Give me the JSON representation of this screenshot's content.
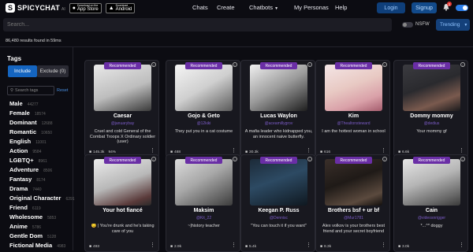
{
  "header": {
    "logo_text": "SPICYCHAT",
    "logo_version": "AI",
    "appstore_small": "Download on the",
    "appstore_big": "App Store",
    "android_small": "Download",
    "android_big": "Android",
    "nav": [
      "Chats",
      "Create",
      "Chatbots",
      "My Personas",
      "Help"
    ],
    "login_label": "Login",
    "signup_label": "Signup",
    "notification_count": "1"
  },
  "search": {
    "placeholder": "Search..."
  },
  "filters": {
    "nsfw_label": "NSFW",
    "sort_label": "Trending"
  },
  "results_text": "86,480 results found in 59ms",
  "sidebar": {
    "title": "Tags",
    "include_label": "Include",
    "exclude_label": "Exclude (0)",
    "search_placeholder": "Search tags",
    "reset_label": "Reset",
    "tags": [
      {
        "name": "Male",
        "count": "44277"
      },
      {
        "name": "Female",
        "count": "18574"
      },
      {
        "name": "Dominant",
        "count": "12688"
      },
      {
        "name": "Romantic",
        "count": "10650"
      },
      {
        "name": "English",
        "count": "11001"
      },
      {
        "name": "Action",
        "count": "9584"
      },
      {
        "name": "LGBTQ+",
        "count": "8961"
      },
      {
        "name": "Adventure",
        "count": "8506"
      },
      {
        "name": "Fantasy",
        "count": "8174"
      },
      {
        "name": "Drama",
        "count": "7440"
      },
      {
        "name": "Original Character",
        "count": "6291"
      },
      {
        "name": "Friend",
        "count": "6119"
      },
      {
        "name": "Wholesome",
        "count": "5853"
      },
      {
        "name": "Anime",
        "count": "5786"
      },
      {
        "name": "Gentle Dom",
        "count": "5128"
      },
      {
        "name": "Fictional Media",
        "count": "4983"
      }
    ]
  },
  "cards": [
    {
      "badge": "Recommended",
      "name": "Caesar",
      "handle": "@januarybay",
      "desc": "Cruel and cold General of the Combat Troops X Ordinary soldier (user)",
      "stat": "145.3k",
      "extra": "94%"
    },
    {
      "badge": "Recommended",
      "name": "Gojo & Geto",
      "handle": "@12kiki",
      "desc": "They put you in a cat costume",
      "stat": "488",
      "extra": ""
    },
    {
      "badge": "Recommended",
      "name": "Lucas Waylon",
      "handle": "@aceamillygrov",
      "desc": "A mafia leader who kidnapped you, an innocent naive butterfly.",
      "stat": "30.3k",
      "extra": ""
    },
    {
      "badge": "Recommended",
      "name": "Kim",
      "handle": "@Thealtonsteward",
      "desc": "I am the hottest woman in school",
      "stat": "616",
      "extra": ""
    },
    {
      "badge": "Recommended",
      "name": "Dommy mommy",
      "handle": "@dedius",
      "desc": "Your mommy gf",
      "stat": "6.6k",
      "extra": ""
    },
    {
      "badge": "Recommended",
      "name": "Your hot fiancé",
      "handle": "",
      "desc": "😏 | You're drunk and he's taking care of you",
      "stat": "493",
      "extra": ""
    },
    {
      "badge": "Recommended",
      "name": "Maksim",
      "handle": "@Kit_22",
      "desc": "~|history teacher",
      "stat": "2.9k",
      "extra": ""
    },
    {
      "badge": "Recommended",
      "name": "Keegan P. Russ",
      "handle": "@Dennisc",
      "desc": "\"You can touch it if you want\"",
      "stat": "5.4k",
      "extra": ""
    },
    {
      "badge": "Recommended",
      "name": "Brothers bsf + ur bf",
      "handle": "@Mur1781",
      "desc": "Alex volkov is your brothers best friend and your secret boyfriend",
      "stat": "8.3k",
      "extra": ""
    },
    {
      "badge": "Recommended",
      "name": "Cain",
      "handle": "@videosnrigger",
      "desc": "*...^* doggy",
      "stat": "3.0k",
      "extra": ""
    }
  ]
}
